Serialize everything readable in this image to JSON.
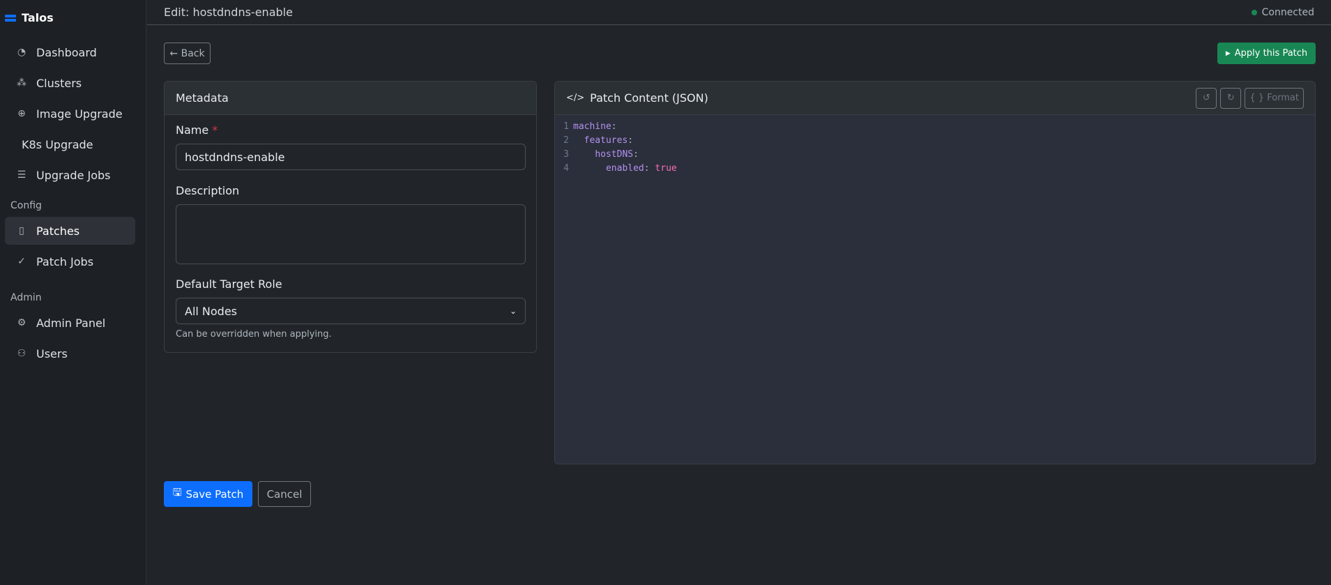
{
  "app": {
    "name": "Talos"
  },
  "sidebar": {
    "items": [
      {
        "label": "Dashboard",
        "icon": "dashboard-icon"
      },
      {
        "label": "Clusters",
        "icon": "clusters-icon"
      },
      {
        "label": "Image Upgrade",
        "icon": "upgrade-icon"
      },
      {
        "label": "K8s Upgrade"
      },
      {
        "label": "Upgrade Jobs",
        "icon": "list-icon"
      }
    ],
    "config_label": "Config",
    "config_items": [
      {
        "label": "Patches",
        "active": true
      },
      {
        "label": "Patch Jobs"
      }
    ],
    "admin_label": "Admin",
    "admin_items": [
      {
        "label": "Admin Panel"
      },
      {
        "label": "Users"
      }
    ]
  },
  "header": {
    "title": "Edit: hostdndns-enable",
    "status": "Connected"
  },
  "toolbar": {
    "back": "← Back",
    "apply": "Apply this Patch"
  },
  "metadata": {
    "title": "Metadata",
    "name_label": "Name",
    "required": "*",
    "name_value": "hostdndns-enable",
    "description_label": "Description",
    "description_value": "",
    "role_label": "Default Target Role",
    "role_value": "All Nodes",
    "role_help": "Can be overridden when applying."
  },
  "editor": {
    "title": "Patch Content (JSON)",
    "format": "Format",
    "lines": [
      {
        "n": "1",
        "indent": "",
        "key": "machine",
        "sep": ":",
        "val": ""
      },
      {
        "n": "2",
        "indent": "  ",
        "key": "features",
        "sep": ":",
        "val": ""
      },
      {
        "n": "3",
        "indent": "    ",
        "key": "hostDNS",
        "sep": ":",
        "val": ""
      },
      {
        "n": "4",
        "indent": "      ",
        "key": "enabled",
        "sep": ": ",
        "val": "true"
      }
    ]
  },
  "actions": {
    "save": "Save Patch",
    "cancel": "Cancel"
  }
}
